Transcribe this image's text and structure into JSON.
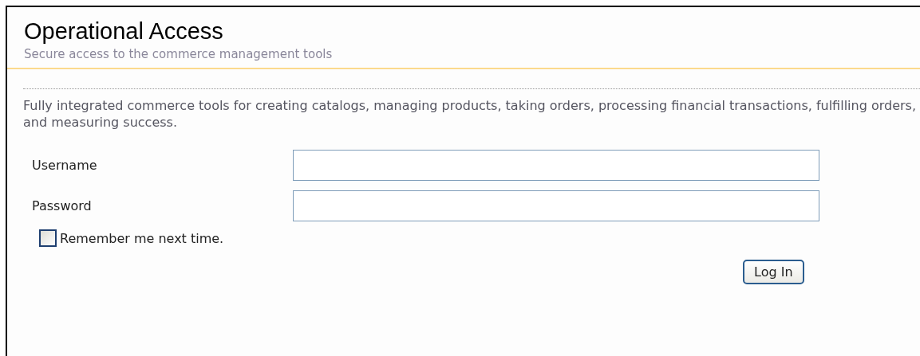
{
  "header": {
    "title": "Operational Access",
    "subtitle": "Secure access to the commerce management tools"
  },
  "intro": "Fully integrated commerce tools for creating catalogs, managing products, taking orders, processing financial transactions, fulfilling orders, and measuring success.",
  "fields": [
    {
      "label": "Username"
    },
    {
      "label": "Password"
    }
  ],
  "remember": {
    "label": "Remember me next time.",
    "checked": false
  },
  "button": "Log In"
}
